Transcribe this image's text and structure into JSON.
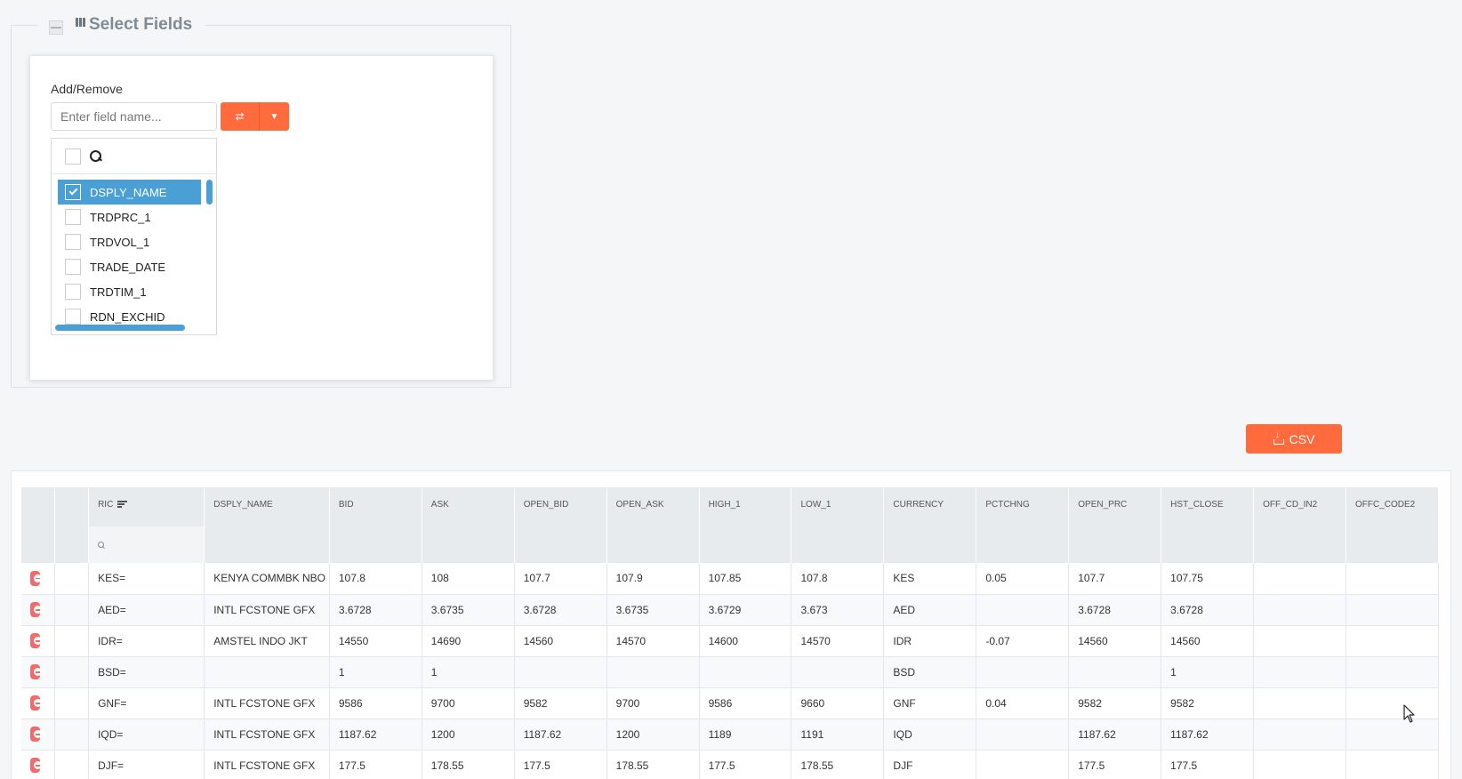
{
  "select_fields": {
    "title": "Select Fields",
    "collapse_symbol": "—",
    "add_remove_label": "Add/Remove",
    "field_input_placeholder": "Enter field name...",
    "swap_icon": "⇄",
    "dropdown_icon": "▼",
    "fields": [
      {
        "label": "DSPLY_NAME",
        "checked": true
      },
      {
        "label": "TRDPRC_1",
        "checked": false
      },
      {
        "label": "TRDVOL_1",
        "checked": false
      },
      {
        "label": "TRADE_DATE",
        "checked": false
      },
      {
        "label": "TRDTIM_1",
        "checked": false
      },
      {
        "label": "RDN_EXCHID",
        "checked": false
      }
    ]
  },
  "csv_button": {
    "label": "CSV",
    "icon": "download-icon"
  },
  "table": {
    "columns": [
      "RIC",
      "DSPLY_NAME",
      "BID",
      "ASK",
      "OPEN_BID",
      "OPEN_ASK",
      "HIGH_1",
      "LOW_1",
      "CURRENCY",
      "PCTCHNG",
      "OPEN_PRC",
      "HST_CLOSE",
      "OFF_CD_IN2",
      "OFFC_CODE2"
    ],
    "sorted_column": "RIC",
    "rows": [
      [
        "KES=",
        "KENYA COMMBK NBO",
        "107.8",
        "108",
        "107.7",
        "107.9",
        "107.85",
        "107.8",
        "KES",
        "0.05",
        "107.7",
        "107.75",
        "",
        ""
      ],
      [
        "AED=",
        "INTL FCSTONE GFX",
        "3.6728",
        "3.6735",
        "3.6728",
        "3.6735",
        "3.6729",
        "3.673",
        "AED",
        "",
        "3.6728",
        "3.6728",
        "",
        ""
      ],
      [
        "IDR=",
        "AMSTEL INDO JKT",
        "14550",
        "14690",
        "14560",
        "14570",
        "14600",
        "14570",
        "IDR",
        "-0.07",
        "14560",
        "14560",
        "",
        ""
      ],
      [
        "BSD=",
        "",
        "1",
        "1",
        "",
        "",
        "",
        "",
        "BSD",
        "",
        "",
        "1",
        "",
        ""
      ],
      [
        "GNF=",
        "INTL FCSTONE GFX",
        "9586",
        "9700",
        "9582",
        "9700",
        "9586",
        "9660",
        "GNF",
        "0.04",
        "9582",
        "9582",
        "",
        ""
      ],
      [
        "IQD=",
        "INTL FCSTONE GFX",
        "1187.62",
        "1200",
        "1187.62",
        "1200",
        "1189",
        "1191",
        "IQD",
        "",
        "1187.62",
        "1187.62",
        "",
        ""
      ],
      [
        "DJF=",
        "INTL FCSTONE GFX",
        "177.5",
        "178.55",
        "177.5",
        "178.55",
        "177.5",
        "178.55",
        "DJF",
        "",
        "177.5",
        "177.5",
        "",
        ""
      ]
    ]
  },
  "colors": {
    "accent": "#ff6b3d",
    "selection": "#4a9fd5",
    "remove": "#f06b6b"
  }
}
